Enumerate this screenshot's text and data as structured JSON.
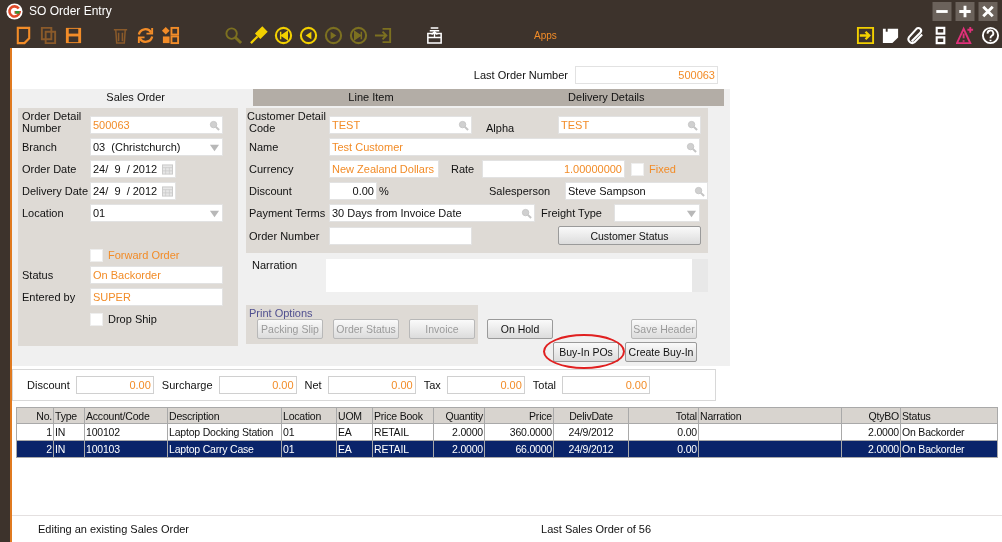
{
  "window": {
    "title": "SO Order Entry"
  },
  "toolbar": {
    "left": [
      {
        "kind": "new-doc",
        "disabled": false
      },
      {
        "kind": "copy-doc",
        "disabled": true
      },
      {
        "kind": "save",
        "disabled": false
      },
      {
        "kind": "trash",
        "disabled": true
      },
      {
        "kind": "refresh",
        "disabled": false
      },
      {
        "kind": "shapes",
        "disabled": false
      }
    ],
    "middle": [
      {
        "kind": "search",
        "disabled": true
      },
      {
        "kind": "flashlight",
        "disabled": false
      },
      {
        "kind": "first",
        "disabled": false
      },
      {
        "kind": "prev",
        "disabled": false
      },
      {
        "kind": "next",
        "disabled": true
      },
      {
        "kind": "last",
        "disabled": true
      },
      {
        "kind": "import",
        "disabled": true
      }
    ],
    "center": [
      {
        "kind": "tray",
        "disabled": false
      }
    ],
    "apps_label": "Apps",
    "right": [
      {
        "kind": "exit",
        "disabled": false
      },
      {
        "kind": "note",
        "disabled": false
      },
      {
        "kind": "clip",
        "disabled": false
      },
      {
        "kind": "layout",
        "disabled": false
      },
      {
        "kind": "alert",
        "disabled": false
      },
      {
        "kind": "help",
        "disabled": false
      }
    ]
  },
  "last_order": {
    "label": "Last Order Number",
    "value": "500063"
  },
  "tabs": [
    {
      "label": "Sales Order",
      "selected": true
    },
    {
      "label": "Line Item",
      "selected": false
    },
    {
      "label": "Delivery Details",
      "selected": false
    }
  ],
  "order_detail": {
    "heading": "Order Detail",
    "number": {
      "label": "Number",
      "value": "500063",
      "kind": "search",
      "readonly": true
    },
    "branch": {
      "label": "Branch",
      "value": "03  (Christchurch)",
      "kind": "dropdown",
      "readonly": false
    },
    "order_date": {
      "label": "Order Date",
      "value": "24/  9  / 2012",
      "kind": "date",
      "readonly": false
    },
    "delivery_date": {
      "label": "Delivery Date",
      "value": "24/  9  / 2012",
      "kind": "date",
      "readonly": false
    },
    "location": {
      "label": "Location",
      "value": "01",
      "kind": "dropdown",
      "readonly": false
    },
    "forward_order": {
      "label": "Forward Order",
      "checked": false,
      "readonly": true
    },
    "status": {
      "label": "Status",
      "value": "On Backorder",
      "readonly": true
    },
    "entered_by": {
      "label": "Entered by",
      "value": "SUPER",
      "readonly": true
    },
    "drop_ship": {
      "label": "Drop Ship",
      "checked": false,
      "readonly": false
    }
  },
  "customer_detail": {
    "heading": "Customer Detail",
    "code": {
      "label": "Code",
      "value": "TEST",
      "kind": "search",
      "readonly": true
    },
    "alpha": {
      "label": "Alpha",
      "value": "TEST",
      "kind": "search",
      "readonly": true
    },
    "name": {
      "label": "Name",
      "value": "Test Customer",
      "kind": "search",
      "readonly": true
    },
    "currency": {
      "label": "Currency",
      "value": "New Zealand Dollars",
      "readonly": true
    },
    "rate": {
      "label": "Rate",
      "value": "1.00000000",
      "readonly": true
    },
    "fixed": {
      "label": "Fixed",
      "checked": false,
      "readonly": true
    },
    "discount": {
      "label": "Discount",
      "value": "0.00",
      "unit": "%",
      "readonly": false
    },
    "salesperson": {
      "label": "Salesperson",
      "value": "Steve Sampson",
      "kind": "search",
      "readonly": false
    },
    "payment_terms": {
      "label": "Payment Terms",
      "value": "30 Days from Invoice Date",
      "kind": "search",
      "readonly": false
    },
    "freight_type": {
      "label": "Freight Type",
      "kind": "dropdown"
    },
    "order_number": {
      "label": "Order Number"
    },
    "customer_status_button": {
      "label": "Customer Status",
      "disabled": false
    }
  },
  "narration": {
    "label": "Narration"
  },
  "print_options": {
    "label": "Print Options",
    "buttons": [
      {
        "label": "Packing Slip",
        "disabled": true
      },
      {
        "label": "Order Status",
        "disabled": true
      },
      {
        "label": "Invoice",
        "disabled": true
      }
    ]
  },
  "on_hold_button": {
    "label": "On Hold",
    "disabled": false
  },
  "save_header_button": {
    "label": "Save Header",
    "disabled": true
  },
  "buy_in_pos_button": {
    "label": "Buy-In POs",
    "disabled": false,
    "circled": true
  },
  "create_buy_in_button": {
    "label": "Create Buy-In",
    "disabled": false
  },
  "totals": [
    {
      "label": "Discount",
      "value": "0.00"
    },
    {
      "label": "Surcharge",
      "value": "0.00"
    },
    {
      "label": "Net",
      "value": "0.00"
    },
    {
      "label": "Tax",
      "value": "0.00"
    },
    {
      "label": "Total",
      "value": "0.00"
    }
  ],
  "table": {
    "columns": [
      "No.",
      "Type",
      "Account/Code",
      "Description",
      "Location",
      "UOM",
      "Price Book",
      "Quantity",
      "Price",
      "DelivDate",
      "Total",
      "Narration",
      "QtyBO",
      "Status"
    ],
    "rows": [
      {
        "selected": false,
        "cells": [
          "1",
          "IN",
          "100102",
          "Laptop Docking Station",
          "01",
          "EA",
          "RETAIL",
          "2.0000",
          "360.0000",
          "24/9/2012",
          "0.00",
          "",
          "2.0000",
          "On Backorder"
        ]
      },
      {
        "selected": true,
        "cells": [
          "2",
          "IN",
          "100103",
          "Laptop Carry Case",
          "01",
          "EA",
          "RETAIL",
          "2.0000",
          "66.0000",
          "24/9/2012",
          "0.00",
          "",
          "2.0000",
          "On Backorder"
        ]
      }
    ]
  },
  "status_bar": {
    "left": "Editing an existing Sales Order",
    "right": "Last Sales Order of 56"
  }
}
